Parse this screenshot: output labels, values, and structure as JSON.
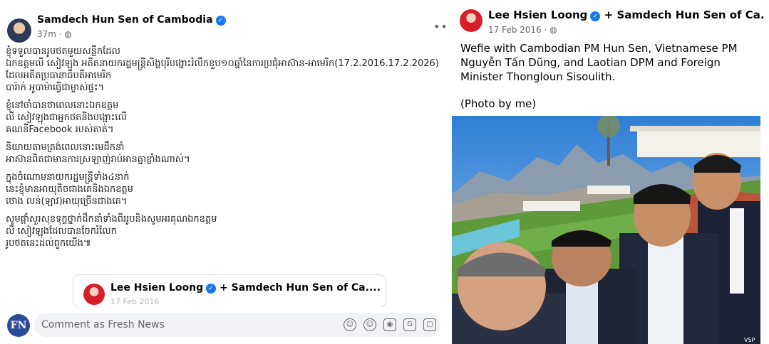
{
  "left_post": {
    "author": "Samdech Hun Sen of Cambodia",
    "time": "37m",
    "paragraphs": [
      "ខ្ញុំទទួលបានរូបថតមួយសន្លឹកដែល\nឯកឧត្តមលី សៀវឡុង អតីតនាយករដ្ឋមន្រ្តីសិង្ហបុរីបង្ហោះរំលឹកខួប១០ឆ្នាំនៃការប្រជុំអាស៊ាន-អាមេរិក(17.2.2016.17.2.2026)\nដែលអតីតប្រធានាធិបតីអាមេរិក\nបារ៉ាក់ អូបាម៉ាធ្វើជាម្ចាស់ផ្ទះ។",
      "ខ្ញុំនៅចាំបានថាពេលនោះឯកឧត្តម\nលី សៀវឡុងជាអ្នកថតនិងបង្ហោះលើ\nគណនីFacebook របស់គាត់។",
      "និយាយតាមត្រង់ពេលនោះមេដឹកនាំ\nអាស៊ានពិតជាមានការស្រឡាញ់រាប់អានគ្នាខ្លាំងណាស់។",
      "ក្នុងចំណោមនាយករដ្ឋមន្ត្រីទាំង៤នាក់\nនេះខ្ញុំមានអាយុតិចជាងគេនិងឯកឧត្តម\nថោង លន់(ឡាវ)អាយុច្រើនជាងគេ។",
      "សូមផ្តាំសួរសុខទុក្ខថ្នាក់ដឹកនាំទាំងពីររូបនិងសូមអរគុណឯកឧត្តម\nលី សៀវឡុងដែលបានចែករំលែក\nរូបថតនេះដល់ពួកយើង៕"
    ],
    "shared": {
      "author": "Lee Hsien Loong",
      "with": "+ Samdech Hun Sen of Ca....",
      "sub": "17 Feb 2016"
    },
    "comment": {
      "logo": "FN",
      "placeholder": "Comment as Fresh News"
    },
    "icons": [
      "sticker-icon",
      "emoji-icon",
      "camera-icon",
      "gif-icon",
      "sticker2-icon"
    ]
  },
  "right_post": {
    "author": "Lee Hsien Loong",
    "with": "+ Samdech Hun Sen of Ca....",
    "date": "17 Feb 2016",
    "paragraphs": [
      "Wefie with Cambodian PM Hun Sen, Vietnamese PM Nguyễn Tấn Dũng, and Laotian DPM and Foreign Minister Thongloun Sisoulith.",
      "(Photo by me)"
    ],
    "photo_credit": "VSP"
  },
  "colors": {
    "verified": "#1877f2",
    "meta": "#65676b",
    "comment_bg": "#f0f2f5"
  }
}
